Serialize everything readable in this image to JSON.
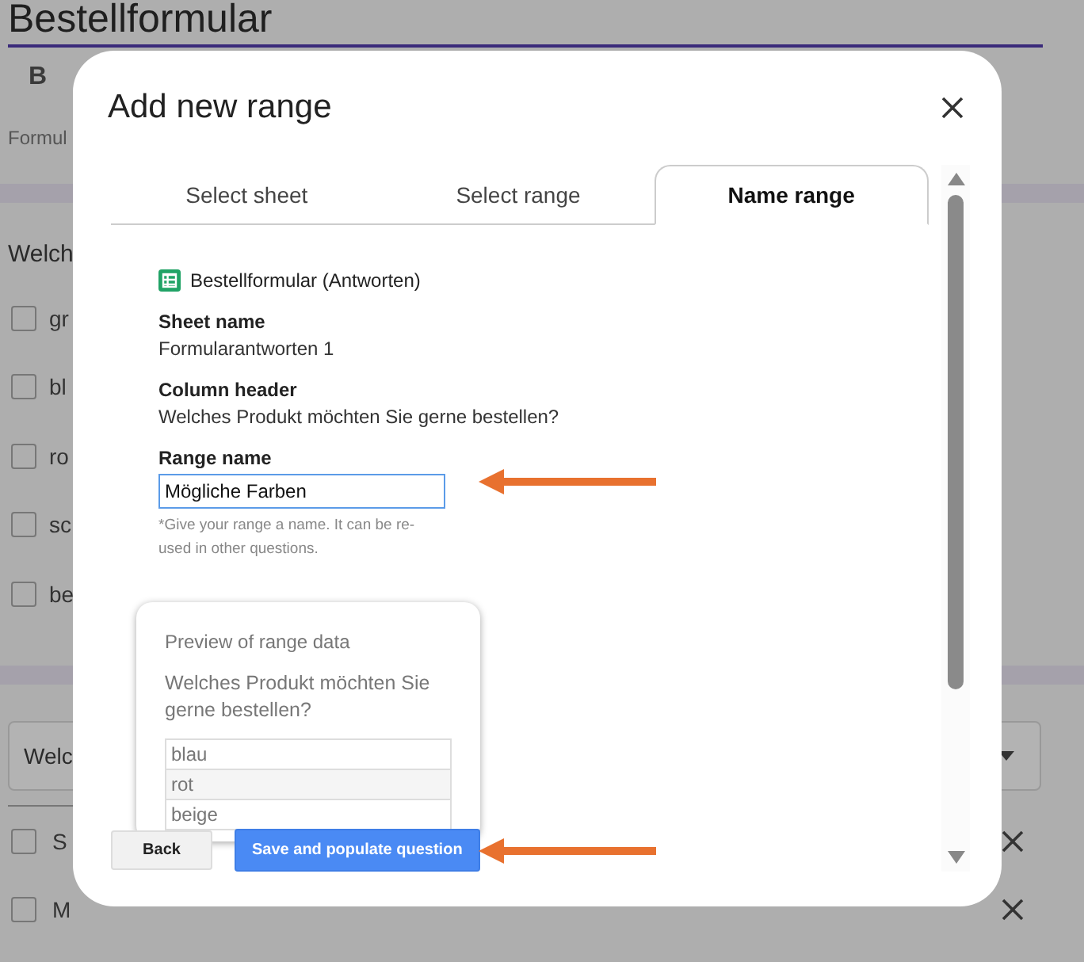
{
  "background": {
    "title": "Bestellformular",
    "section_label": "B",
    "section_text": "Formul",
    "question_1": {
      "title": "Welch",
      "options": [
        {
          "label": "gr",
          "checked": false
        },
        {
          "label": "bl",
          "checked": false
        },
        {
          "label": "ro",
          "checked": false
        },
        {
          "label": "sc",
          "checked": false
        },
        {
          "label": "be",
          "checked": false
        }
      ]
    },
    "question_2": {
      "dropdown": "Welc",
      "options": [
        {
          "label": "S",
          "checked": false
        },
        {
          "label": "M",
          "checked": false
        }
      ]
    }
  },
  "dialog": {
    "title": "Add new range",
    "tabs": [
      {
        "label": "Select sheet",
        "selected": false
      },
      {
        "label": "Select range",
        "selected": false
      },
      {
        "label": "Name range",
        "selected": true
      }
    ],
    "spreadsheet": "Bestellformular (Antworten)",
    "fields": [
      {
        "label": "Sheet name",
        "value": "Formularantworten 1"
      },
      {
        "label": "Column header",
        "value": "Welches Produkt möchten Sie gerne bestellen?"
      }
    ],
    "range_name": {
      "label": "Range name",
      "value": "Mögliche Farben",
      "hint": "*Give your range a name. It can be re-used in other questions."
    },
    "preview": {
      "title": "Preview of range data",
      "question": "Welches Produkt möchten Sie gerne bestellen?",
      "rows": [
        "blau",
        "rot",
        "beige"
      ]
    },
    "buttons": [
      {
        "label": "Back",
        "kind": "secondary"
      },
      {
        "label": "Save and populate question",
        "kind": "primary"
      }
    ]
  }
}
